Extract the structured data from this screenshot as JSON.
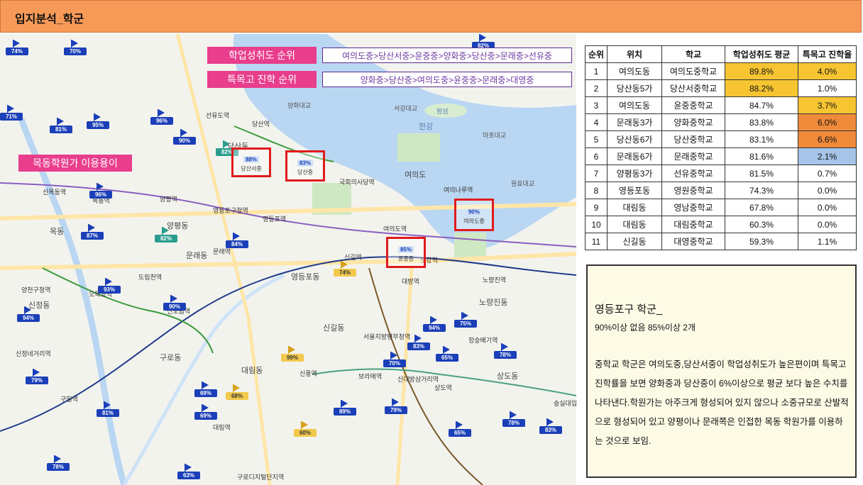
{
  "header": {
    "title": "입지분석_학군"
  },
  "legend": {
    "achievement_label": "학업성취도 순위",
    "achievement_order": "여의도중>당산서중>윤중중>양화중>당산중>문래중>선유중",
    "special_label": "특목고 진학 순위",
    "special_order": "양화중>당산중>여의도중>윤중중>문래중>대영중",
    "academy_label": "목동학원가 이용용이"
  },
  "map": {
    "labels": [
      "신목동역",
      "목동역",
      "오목교역",
      "양평역",
      "영등포구청역",
      "당산역",
      "선유도역",
      "국회의사당역",
      "여의도역",
      "여의나루역",
      "샛강역",
      "신길역",
      "영등포역",
      "신풍역",
      "대림역",
      "보라매역",
      "대방역",
      "노량진역",
      "신대방삼거리역",
      "구로디지털단지역",
      "구일역",
      "신도림역",
      "문래역",
      "도림천역",
      "양천구청역",
      "신정네거리역",
      "서울지방병무청역",
      "장승배기역",
      "상도역",
      "숭실대입구역",
      "여의도",
      "양평동",
      "문래동",
      "영등포동",
      "신길동",
      "대림동",
      "신정동",
      "목동",
      "구로동",
      "당산동",
      "한강",
      "밤섬",
      "노량진동",
      "상도동",
      "양화대교",
      "서강대교",
      "마포대교",
      "원효대교"
    ],
    "school_highlights": [
      {
        "name": "당산서중",
        "pct": "88%"
      },
      {
        "name": "당산중",
        "pct": "83%"
      },
      {
        "name": "여의도중",
        "pct": "90%"
      },
      {
        "name": "윤중중",
        "pct": "85%"
      }
    ],
    "pins": [
      {
        "pct": "74%",
        "style": "blue"
      },
      {
        "pct": "70%",
        "style": "blue"
      },
      {
        "pct": "82%",
        "style": "blue"
      },
      {
        "pct": "71%",
        "style": "blue"
      },
      {
        "pct": "81%",
        "style": "blue"
      },
      {
        "pct": "95%",
        "style": "blue"
      },
      {
        "pct": "96%",
        "style": "blue"
      },
      {
        "pct": "90%",
        "style": "blue"
      },
      {
        "pct": "82%",
        "style": "teal"
      },
      {
        "pct": "96%",
        "style": "blue"
      },
      {
        "pct": "87%",
        "style": "blue"
      },
      {
        "pct": "82%",
        "style": "teal"
      },
      {
        "pct": "84%",
        "style": "blue"
      },
      {
        "pct": "74%",
        "style": "gold"
      },
      {
        "pct": "93%",
        "style": "blue"
      },
      {
        "pct": "90%",
        "style": "blue"
      },
      {
        "pct": "94%",
        "style": "blue"
      },
      {
        "pct": "94%",
        "style": "blue"
      },
      {
        "pct": "75%",
        "style": "blue"
      },
      {
        "pct": "83%",
        "style": "blue"
      },
      {
        "pct": "99%",
        "style": "gold"
      },
      {
        "pct": "70%",
        "style": "blue"
      },
      {
        "pct": "65%",
        "style": "blue"
      },
      {
        "pct": "78%",
        "style": "blue"
      },
      {
        "pct": "79%",
        "style": "blue"
      },
      {
        "pct": "69%",
        "style": "blue"
      },
      {
        "pct": "68%",
        "style": "gold"
      },
      {
        "pct": "69%",
        "style": "blue"
      },
      {
        "pct": "81%",
        "style": "blue"
      },
      {
        "pct": "89%",
        "style": "blue"
      },
      {
        "pct": "79%",
        "style": "blue"
      },
      {
        "pct": "60%",
        "style": "gold"
      },
      {
        "pct": "65%",
        "style": "blue"
      },
      {
        "pct": "78%",
        "style": "blue"
      },
      {
        "pct": "83%",
        "style": "blue"
      },
      {
        "pct": "78%",
        "style": "blue"
      },
      {
        "pct": "63%",
        "style": "blue"
      }
    ]
  },
  "table": {
    "headers": [
      "순위",
      "위치",
      "학교",
      "학업성취도 평균",
      "특목고 진학율"
    ],
    "rows": [
      {
        "rank": "1",
        "loc": "여의도동",
        "school": "여의도중학교",
        "avg": "89.8%",
        "special": "4.0%",
        "avg_hl": "yellow",
        "sp_hl": "yellow"
      },
      {
        "rank": "2",
        "loc": "당산동5가",
        "school": "당산서중학교",
        "avg": "88.2%",
        "special": "1.0%",
        "avg_hl": "yellow",
        "sp_hl": ""
      },
      {
        "rank": "3",
        "loc": "여의도동",
        "school": "윤중중학교",
        "avg": "84.7%",
        "special": "3.7%",
        "avg_hl": "",
        "sp_hl": "yellow"
      },
      {
        "rank": "4",
        "loc": "문래동3가",
        "school": "양화중학교",
        "avg": "83.8%",
        "special": "6.0%",
        "avg_hl": "",
        "sp_hl": "orange"
      },
      {
        "rank": "5",
        "loc": "당산동6가",
        "school": "당산중학교",
        "avg": "83.1%",
        "special": "6.6%",
        "avg_hl": "",
        "sp_hl": "orange"
      },
      {
        "rank": "6",
        "loc": "문래동6가",
        "school": "문래중학교",
        "avg": "81.6%",
        "special": "2.1%",
        "avg_hl": "",
        "sp_hl": "blue"
      },
      {
        "rank": "7",
        "loc": "양평동3가",
        "school": "선유중학교",
        "avg": "81.5%",
        "special": "0.7%",
        "avg_hl": "",
        "sp_hl": ""
      },
      {
        "rank": "8",
        "loc": "영등포동",
        "school": "영원중학교",
        "avg": "74.3%",
        "special": "0.0%",
        "avg_hl": "",
        "sp_hl": ""
      },
      {
        "rank": "9",
        "loc": "대림동",
        "school": "영남중학교",
        "avg": "67.8%",
        "special": "0.0%",
        "avg_hl": "",
        "sp_hl": ""
      },
      {
        "rank": "10",
        "loc": "대림동",
        "school": "대림중학교",
        "avg": "60.3%",
        "special": "0.0%",
        "avg_hl": "",
        "sp_hl": ""
      },
      {
        "rank": "11",
        "loc": "신길동",
        "school": "대영중학교",
        "avg": "59.3%",
        "special": "1.1%",
        "avg_hl": "",
        "sp_hl": ""
      }
    ],
    "highlight_colors": {
      "yellow": "#f7c531",
      "orange": "#ef8a3b",
      "blue": "#a6c4e8"
    }
  },
  "note": {
    "heading": "영등포구 학군_",
    "subheading": "90%이상 없음 85%이상 2개",
    "body": "중학교 학군은 여의도중,당산서중이 학업성취도가 높은편이며 특목고 진학률을 보면 양화중과 당산중이 6%이상으로 평균 보다 높은 수치를 나타낸다.학원가는 아주크게 형성되어 있지 않으나 소중규모로 산발적으로 형성되어 있고 양평이나 문래쪽은 인접한 목동 학원가를 이용하는 것으로 보임."
  }
}
